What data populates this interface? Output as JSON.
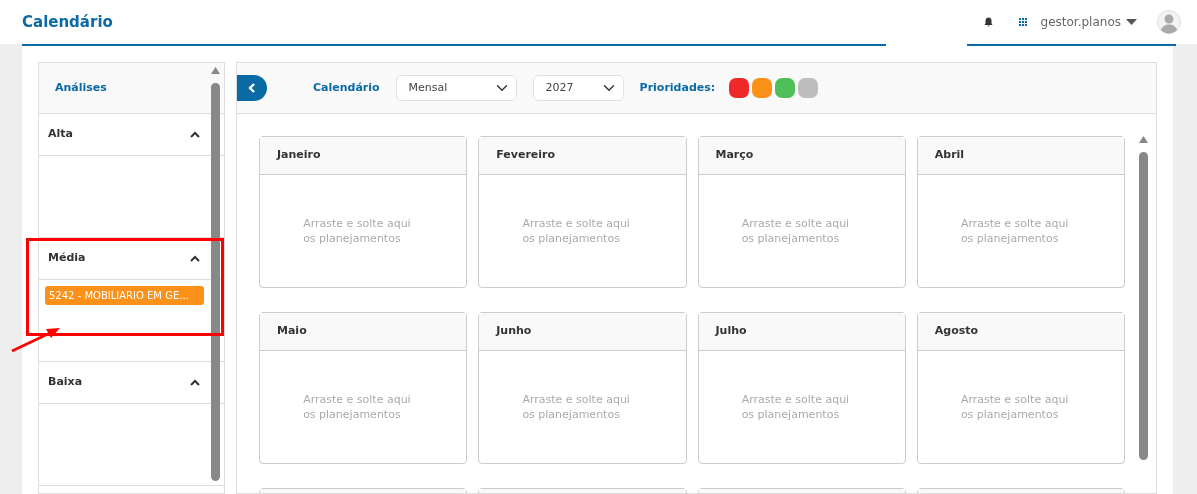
{
  "header": {
    "title": "Calendário",
    "user": "gestor.planos"
  },
  "sidebar": {
    "title": "Análises",
    "groups": [
      {
        "label": "Alta",
        "expanded": true
      },
      {
        "label": "Média",
        "expanded": true,
        "items": [
          "5242 - MOBILIARIO EM GE..."
        ]
      },
      {
        "label": "Baixa",
        "expanded": true
      }
    ]
  },
  "toolbar": {
    "label": "Calendário",
    "view": "Mensal",
    "year": "2027",
    "priorities_label": "Prioridades:",
    "priorities": [
      {
        "color": "#f0282a"
      },
      {
        "color": "#fb9118"
      },
      {
        "color": "#4fbf5a"
      },
      {
        "color": "#bdbdbd"
      }
    ]
  },
  "months": [
    {
      "kind": "month",
      "name": "Janeiro",
      "placeholder": "Arraste e solte aqui os planejamentos"
    },
    {
      "kind": "month",
      "name": "Fevereiro",
      "placeholder": "Arraste e solte aqui os planejamentos"
    },
    {
      "kind": "month",
      "name": "Março",
      "placeholder": "Arraste e solte aqui os planejamentos"
    },
    {
      "kind": "month",
      "name": "Abril",
      "placeholder": "Arraste e solte aqui os planejamentos"
    },
    {
      "kind": "month",
      "name": "Maio",
      "placeholder": "Arraste e solte aqui os planejamentos"
    },
    {
      "kind": "month",
      "name": "Junho",
      "placeholder": "Arraste e solte aqui os planejamentos"
    },
    {
      "kind": "month",
      "name": "Julho",
      "placeholder": "Arraste e solte aqui os planejamentos"
    },
    {
      "kind": "month",
      "name": "Agosto",
      "placeholder": "Arraste e solte aqui os planejamentos"
    },
    {
      "kind": "partial"
    },
    {
      "kind": "partial"
    },
    {
      "kind": "partial"
    },
    {
      "kind": "partial"
    }
  ],
  "annotation": {
    "kind": "highlight-box"
  }
}
